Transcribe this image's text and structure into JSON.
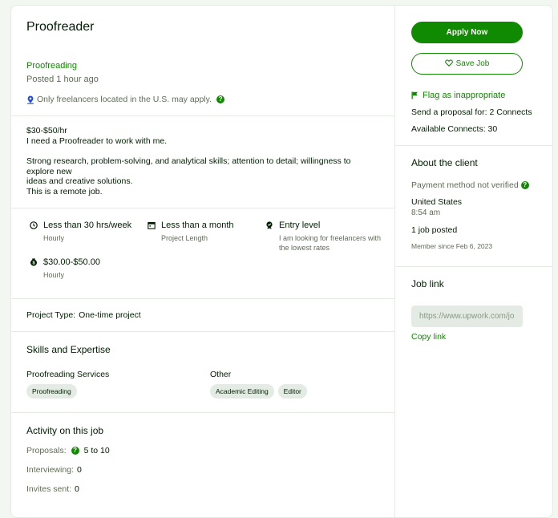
{
  "job": {
    "title": "Proofreader",
    "category": "Proofreading",
    "posted": "Posted 1 hour ago",
    "location_note": "Only freelancers located in the U.S. may apply."
  },
  "description": {
    "rate": "$30-$50/hr",
    "line1": "I need a Proofreader to work with me.",
    "line2": "Strong research, problem-solving, and analytical skills; attention to detail; willingness to explore new\nideas and creative solutions.",
    "line3": "This is a remote job."
  },
  "features": {
    "hours": {
      "title": "Less than 30 hrs/week",
      "sub": "Hourly",
      "icon": "clock-icon"
    },
    "duration": {
      "title": "Less than a month",
      "sub": "Project Length",
      "icon": "calendar-icon"
    },
    "level": {
      "title": "Entry level",
      "sub": "I am looking for freelancers with\nthe lowest rates",
      "icon": "experience-icon"
    },
    "rate": {
      "title": "$30.00-$50.00",
      "sub": "Hourly",
      "icon": "money-icon"
    }
  },
  "project_type": {
    "label": "Project Type:",
    "value": "One-time project"
  },
  "skills": {
    "heading": "Skills and Expertise",
    "groups": [
      {
        "label": "Proofreading Services",
        "chips": [
          "Proofreading"
        ]
      },
      {
        "label": "Other",
        "chips": [
          "Academic Editing",
          "Editor"
        ]
      }
    ]
  },
  "activity": {
    "heading": "Activity on this job",
    "proposals_label": "Proposals:",
    "proposals_value": "5 to 10",
    "interviewing_label": "Interviewing:",
    "interviewing_value": "0",
    "invites_label": "Invites sent:",
    "invites_value": "0"
  },
  "sidebar": {
    "apply_label": "Apply Now",
    "save_label": "Save Job",
    "flag_label": "Flag as inappropriate",
    "proposal_cost": "Send a proposal for: 2 Connects",
    "available": "Available Connects: 30"
  },
  "client": {
    "heading": "About the client",
    "payment": "Payment method not verified",
    "country": "United States",
    "time": "8:54 am",
    "jobs_posted": "1 job posted",
    "member_since": "Member since Feb 6, 2023"
  },
  "job_link": {
    "heading": "Job link",
    "url": "https://www.upwork.com/jobs/",
    "copy_label": "Copy link"
  },
  "colors": {
    "accent": "#108a00",
    "border": "#e4ebe4",
    "muted": "#5e6d55"
  }
}
